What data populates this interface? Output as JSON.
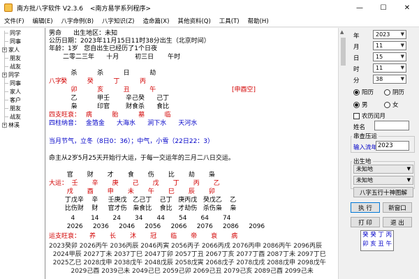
{
  "window": {
    "title": "南方批八字软件 V2.3.6",
    "subtitle": "<南方易学系列程序>",
    "minimize": "—",
    "maximize": "☐",
    "close": "✕"
  },
  "menu": [
    "文件(F)",
    "编辑(E)",
    "八字命例(B)",
    "八字知识(Z)",
    "造命篇(X)",
    "其他资料(Q)",
    "工具(T)",
    "帮助(H)"
  ],
  "tree": [
    {
      "label": "同学",
      "type": "leaf"
    },
    {
      "label": "同事",
      "type": "leaf"
    },
    {
      "label": "家人",
      "type": "expand"
    },
    {
      "label": "朋友",
      "type": "leaf"
    },
    {
      "label": "战友",
      "type": "leaf"
    },
    {
      "label": "同学",
      "type": "expand"
    },
    {
      "label": "同事",
      "type": "leaf"
    },
    {
      "label": "家人",
      "type": "leaf"
    },
    {
      "label": "客户",
      "type": "leaf"
    },
    {
      "label": "朋友",
      "type": "leaf"
    },
    {
      "label": "战友",
      "type": "leaf"
    },
    {
      "label": "林溪",
      "type": "expand"
    }
  ],
  "chart": {
    "l1": "男命      出生地区：未知",
    "l2": "公历日期：2023年11月15日11时38分出生（北京时间）",
    "l3": "年龄：1岁   您自出生已经历了1个日夜",
    "l4": "       二零二三年      十月        初三日       午时",
    "l5_gods": "           杀          杀          日          劫",
    "l6_label": "八字：",
    "l6_gan": "      癸          癸          丁          丙",
    "l7_zhi": "           卯          亥          丑          午",
    "l7_kong": "[申酉空]",
    "l8": "           乙          甲壬        辛己癸      己丁",
    "l9": "           枭          印官        财食杀      食比",
    "l10_label": "四支旺衰：",
    "l10_vals": " 病          胎          墓          临",
    "l11_label": "四柱纳音：",
    "l11_vals": " 金箔金      大海水      涧下水      天河水",
    "l12": "当月节气，立冬（8日0：36）；中气，小雪（22日22：3）",
    "l13": "命主从2岁5月25天开始行大运，于每一交运年的三月二八日交运。",
    "l14_gods": "         官       财       才       食       伤       比       劫       枭",
    "l15_label": "大运：",
    "l15_gan": "   壬       辛       庚       己       戊       丁       丙       乙",
    "l16_zhi": "         戌       酉       申       未       午       巳       辰       卯",
    "l17": "        丁戊辛    辛     壬庚戊   乙己丁    己丁   庚丙戊   癸戊乙    乙",
    "l18": "        比伤财    财     官才伤   枭食比    食比   才劫伤   杀伤枭    枭",
    "l19": "           4        14       24       34       44       54       64       74",
    "l20": "         2026     2036     2046     2056     2066     2076     2086     2096",
    "l21_label": "运支旺衰：",
    "l21_vals": "养       长       沐       冠       临       帝       衰       病",
    "rows": [
      "2023癸卯 2026丙午 2036丙辰 2046丙寅 2056丙子 2066丙戌 2076丙申 2086丙午 2096丙辰",
      "  2024甲辰 2027丁未 2037丁巳 2047丁卯 2057丁丑 2067丁亥 2077丁酉 2087丁未 2097丁巳",
      "  2025乙巳 2028戊申 2038戊午 2048戊辰 2058戊寅 2068戊子 2078戊戌 2088戊申 2098戊午",
      "           2029己酉 2039己未 2049己巳 2059己卯 2069己丑 2079己亥 2089己酉 2099己未"
    ]
  },
  "panel": {
    "year_label": "年",
    "year": "2023",
    "month_label": "月",
    "month": "11",
    "day_label": "日",
    "day": "15",
    "hour_label": "时",
    "hour": "11",
    "minute_label": "分",
    "minute": "38",
    "cal_solar": "阳历",
    "cal_lunar": "阴历",
    "male": "男",
    "female": "女",
    "leap": "农历闰月",
    "name_label": "姓名",
    "query_group": "串查压运",
    "flow_year_label": "输入流年",
    "flow_year": "2023",
    "birthplace_group": "出生地",
    "place1": "未知地",
    "place2": "未知地",
    "diagram_btn": "八字五行十神图解",
    "execute_btn": "执 行",
    "new_window_btn": "新窗口",
    "print_btn": "打 印",
    "exit_btn": "退 出",
    "gz_line1": "癸 癸 丁 丙",
    "gz_line2": "卯 亥 丑 午"
  },
  "colors": {
    "red": "#d20000",
    "blue": "#0000c8",
    "accent": "#0078d7"
  }
}
